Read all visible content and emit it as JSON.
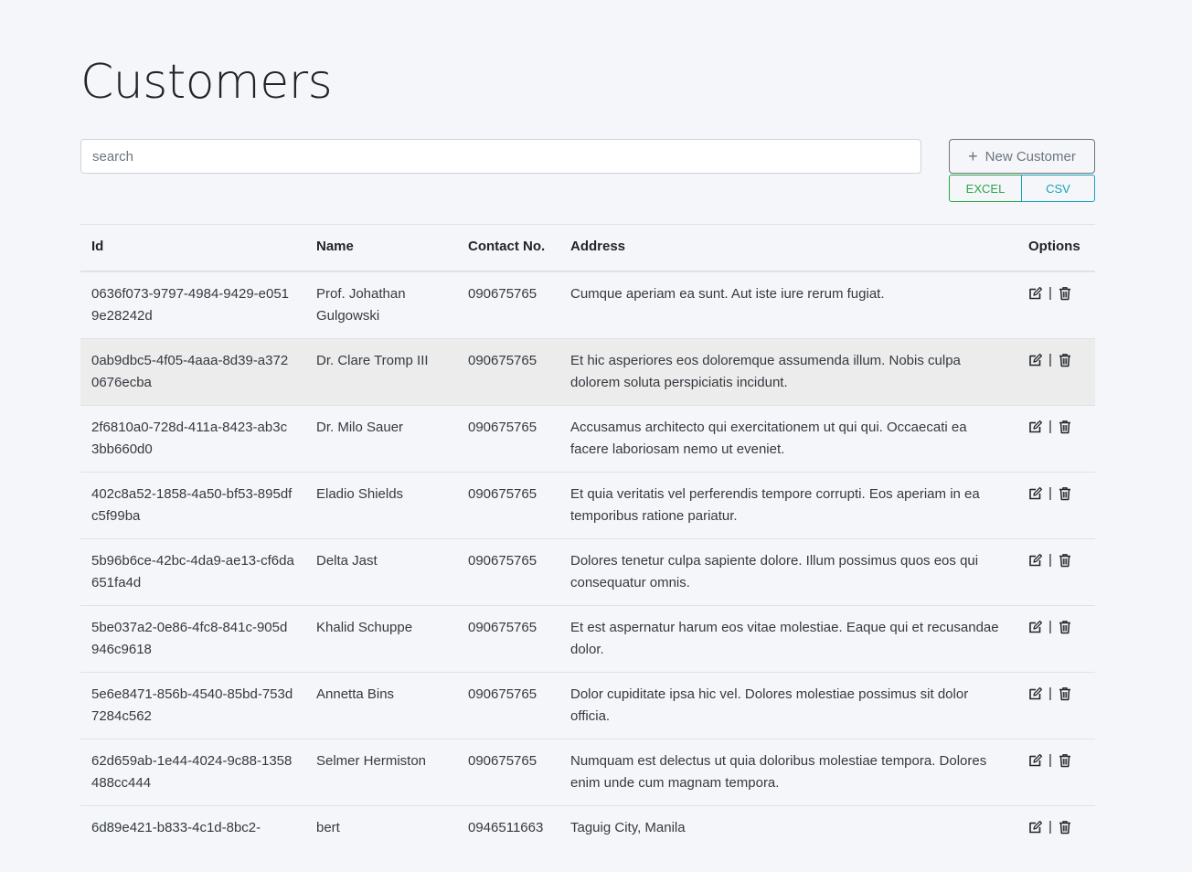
{
  "page": {
    "title": "Customers"
  },
  "search": {
    "placeholder": "search",
    "value": ""
  },
  "actions": {
    "new_customer_label": "New Customer",
    "excel_label": "EXCEL",
    "csv_label": "CSV"
  },
  "table": {
    "headers": {
      "id": "Id",
      "name": "Name",
      "contact": "Contact No.",
      "address": "Address",
      "options": "Options"
    },
    "rows": [
      {
        "id": "0636f073-9797-4984-9429-e0519e28242d",
        "name": "Prof. Johathan Gulgowski",
        "contact": "090675765",
        "address": "Cumque aperiam ea sunt. Aut iste iure rerum fugiat."
      },
      {
        "id": "0ab9dbc5-4f05-4aaa-8d39-a3720676ecba",
        "name": "Dr. Clare Tromp III",
        "contact": "090675765",
        "address": "Et hic asperiores eos doloremque assumenda illum. Nobis culpa dolorem soluta perspiciatis incidunt."
      },
      {
        "id": "2f6810a0-728d-411a-8423-ab3c3bb660d0",
        "name": "Dr. Milo Sauer",
        "contact": "090675765",
        "address": "Accusamus architecto qui exercitationem ut qui qui. Occaecati ea facere laboriosam nemo ut eveniet."
      },
      {
        "id": "402c8a52-1858-4a50-bf53-895dfc5f99ba",
        "name": "Eladio Shields",
        "contact": "090675765",
        "address": "Et quia veritatis vel perferendis tempore corrupti. Eos aperiam in ea temporibus ratione pariatur."
      },
      {
        "id": "5b96b6ce-42bc-4da9-ae13-cf6da651fa4d",
        "name": "Delta Jast",
        "contact": "090675765",
        "address": "Dolores tenetur culpa sapiente dolore. Illum possimus quos eos qui consequatur omnis."
      },
      {
        "id": "5be037a2-0e86-4fc8-841c-905d946c9618",
        "name": "Khalid Schuppe",
        "contact": "090675765",
        "address": "Et est aspernatur harum eos vitae molestiae. Eaque qui et recusandae dolor."
      },
      {
        "id": "5e6e8471-856b-4540-85bd-753d7284c562",
        "name": "Annetta Bins",
        "contact": "090675765",
        "address": "Dolor cupiditate ipsa hic vel. Dolores molestiae possimus sit dolor officia."
      },
      {
        "id": "62d659ab-1e44-4024-9c88-1358488cc444",
        "name": "Selmer Hermiston",
        "contact": "090675765",
        "address": "Numquam est delectus ut quia doloribus molestiae tempora. Dolores enim unde cum magnam tempora."
      },
      {
        "id": "6d89e421-b833-4c1d-8bc2-",
        "name": "bert",
        "contact": "0946511663",
        "address": "Taguig City, Manila"
      }
    ],
    "hovered_row_index": 1,
    "row_option_separator": "|",
    "row_icons": [
      "edit-icon",
      "trash-icon"
    ]
  }
}
